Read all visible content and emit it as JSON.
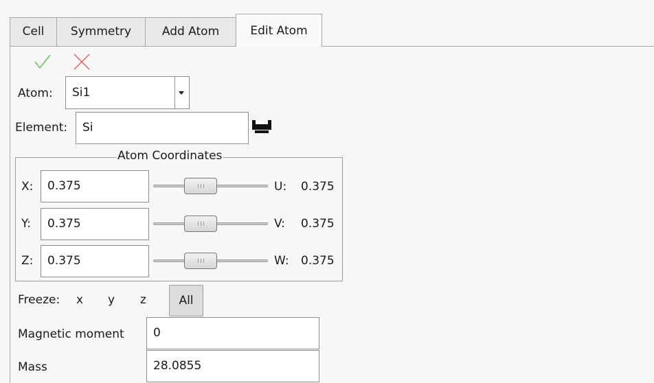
{
  "tabs": [
    "Cell",
    "Symmetry",
    "Add Atom",
    "Edit Atom"
  ],
  "actions": {
    "apply_icon": "checkmark-icon",
    "cancel_icon": "cross-icon",
    "apply_color": "#6bc06b",
    "cancel_color": "#e06060"
  },
  "atom": {
    "label": "Atom:",
    "value": "Si1"
  },
  "element": {
    "label": "Element:",
    "value": "Si",
    "picker_icon": "periodic-table-icon"
  },
  "coords": {
    "title": "Atom Coordinates",
    "rows": [
      {
        "label": "X:",
        "value": "0.375",
        "frac_label": "U:",
        "frac_value": "0.375",
        "slider": 0.375
      },
      {
        "label": "Y:",
        "value": "0.375",
        "frac_label": "V:",
        "frac_value": "0.375",
        "slider": 0.375
      },
      {
        "label": "Z:",
        "value": "0.375",
        "frac_label": "W:",
        "frac_value": "0.375",
        "slider": 0.375
      }
    ]
  },
  "freeze": {
    "label": "Freeze:",
    "x": "x",
    "y": "y",
    "z": "z",
    "all": "All"
  },
  "magnetic": {
    "label": "Magnetic moment",
    "value": "0"
  },
  "mass": {
    "label": "Mass",
    "value": "28.0855"
  }
}
